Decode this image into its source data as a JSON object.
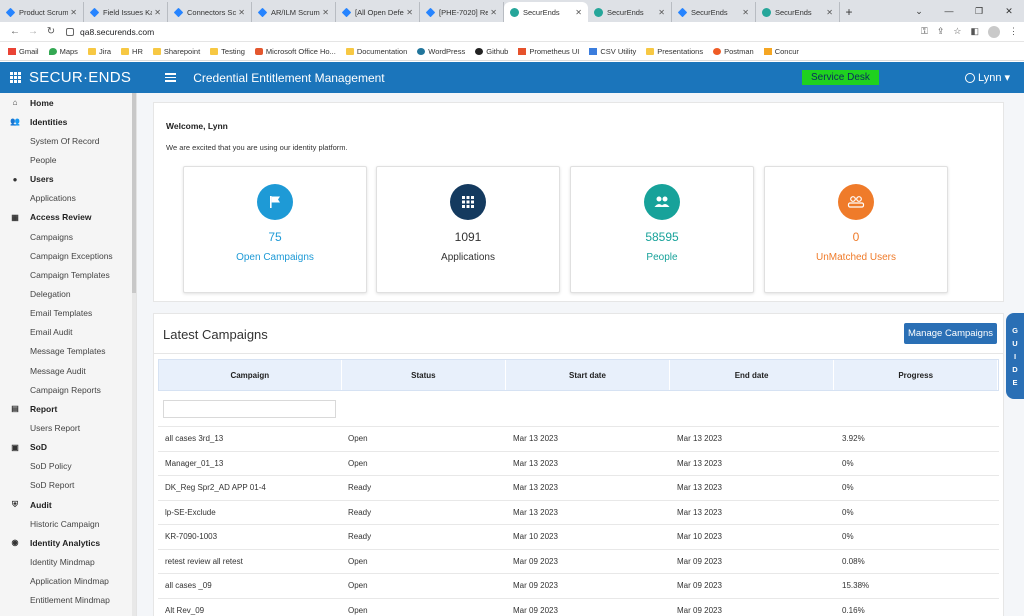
{
  "browser": {
    "tabs": [
      {
        "title": "Product Scrum",
        "type": "jira"
      },
      {
        "title": "Field Issues Ka",
        "type": "jira"
      },
      {
        "title": "Connectors Sc",
        "type": "jira"
      },
      {
        "title": "AR/ILM Scrum",
        "type": "jira"
      },
      {
        "title": "[All Open Defe",
        "type": "jira"
      },
      {
        "title": "[PHE-7020] Re",
        "type": "jira"
      },
      {
        "title": "SecurEnds",
        "type": "se",
        "active": true
      },
      {
        "title": "SecurEnds",
        "type": "se"
      },
      {
        "title": "SecurEnds",
        "type": "jira"
      },
      {
        "title": "SecurEnds",
        "type": "se"
      }
    ],
    "url": "qa8.securends.com",
    "bookmarks": [
      {
        "label": "Gmail",
        "icon": "gmail"
      },
      {
        "label": "Maps",
        "icon": "maps"
      },
      {
        "label": "Jira",
        "icon": "folder"
      },
      {
        "label": "HR",
        "icon": "folder"
      },
      {
        "label": "Sharepoint",
        "icon": "folder"
      },
      {
        "label": "Testing",
        "icon": "folder"
      },
      {
        "label": "Microsoft Office Ho...",
        "icon": "ms"
      },
      {
        "label": "Documentation",
        "icon": "folder"
      },
      {
        "label": "WordPress",
        "icon": "wp"
      },
      {
        "label": "Github",
        "icon": "gh"
      },
      {
        "label": "Prometheus UI",
        "icon": "pr"
      },
      {
        "label": "CSV Utility",
        "icon": "csv"
      },
      {
        "label": "Presentations",
        "icon": "folder"
      },
      {
        "label": "Postman",
        "icon": "pm"
      },
      {
        "label": "Concur",
        "icon": "cc"
      }
    ]
  },
  "header": {
    "logo": "SECUR·ENDS",
    "title": "Credential Entitlement Management",
    "service_desk": "Service Desk",
    "user": "Lynn",
    "brand_color": "#1b75bb"
  },
  "sidebar": {
    "items": [
      {
        "label": "Home",
        "section": true,
        "icon": "home-icon",
        "glyph": "⌂"
      },
      {
        "label": "Identities",
        "section": true,
        "icon": "people-icon",
        "glyph": "👥"
      },
      {
        "label": "System Of Record"
      },
      {
        "label": "People"
      },
      {
        "label": "Users",
        "section": true,
        "icon": "user-icon",
        "glyph": "●"
      },
      {
        "label": "Applications"
      },
      {
        "label": "Access Review",
        "section": true,
        "icon": "grid-icon",
        "glyph": "▦"
      },
      {
        "label": "Campaigns"
      },
      {
        "label": "Campaign Exceptions"
      },
      {
        "label": "Campaign Templates"
      },
      {
        "label": "Delegation"
      },
      {
        "label": "Email Templates"
      },
      {
        "label": "Email Audit"
      },
      {
        "label": "Message Templates"
      },
      {
        "label": "Message Audit"
      },
      {
        "label": "Campaign Reports"
      },
      {
        "label": "Report",
        "section": true,
        "icon": "report-icon",
        "glyph": "▤"
      },
      {
        "label": "Users Report"
      },
      {
        "label": "SoD",
        "section": true,
        "icon": "sod-icon",
        "glyph": "▣"
      },
      {
        "label": "SoD Policy"
      },
      {
        "label": "SoD Report"
      },
      {
        "label": "Audit",
        "section": true,
        "icon": "shield-icon",
        "glyph": "⛨"
      },
      {
        "label": "Historic Campaign"
      },
      {
        "label": "Identity Analytics",
        "section": true,
        "icon": "analytics-icon",
        "glyph": "◉"
      },
      {
        "label": "Identity Mindmap"
      },
      {
        "label": "Application Mindmap"
      },
      {
        "label": "Entitlement Mindmap"
      }
    ]
  },
  "welcome": {
    "title": "Welcome, Lynn",
    "subtitle": "We are excited that you are using our identity platform."
  },
  "stats": [
    {
      "value": "75",
      "label": "Open Campaigns",
      "color": "#1e9ad6",
      "text_color": "#1e9ad6",
      "icon": "flag-icon"
    },
    {
      "value": "1091",
      "label": "Applications",
      "color": "#143a5f",
      "text_color": "#333333",
      "icon": "apps-grid-icon"
    },
    {
      "value": "58595",
      "label": "People",
      "color": "#17a29a",
      "text_color": "#17a29a",
      "icon": "people-icon"
    },
    {
      "value": "0",
      "label": "UnMatched Users",
      "color": "#ef7b2a",
      "text_color": "#ef7b2a",
      "icon": "unmatched-users-icon"
    }
  ],
  "campaigns": {
    "title": "Latest Campaigns",
    "manage_label": "Manage Campaigns",
    "columns": [
      "Campaign",
      "Status",
      "Start date",
      "End date",
      "Progress"
    ],
    "rows": [
      [
        "all cases 3rd_13",
        "Open",
        "Mar 13 2023",
        "Mar 13 2023",
        "3.92%"
      ],
      [
        "Manager_01_13",
        "Open",
        "Mar 13 2023",
        "Mar 13 2023",
        "0%"
      ],
      [
        "DK_Reg Spr2_AD APP 01-4",
        "Ready",
        "Mar 13 2023",
        "Mar 13 2023",
        "0%"
      ],
      [
        "lp-SE-Exclude",
        "Ready",
        "Mar 13 2023",
        "Mar 13 2023",
        "0%"
      ],
      [
        "KR-7090-1003",
        "Ready",
        "Mar 10 2023",
        "Mar 10 2023",
        "0%"
      ],
      [
        "retest review all retest",
        "Open",
        "Mar 09 2023",
        "Mar 09 2023",
        "0.08%"
      ],
      [
        "all cases _09",
        "Open",
        "Mar 09 2023",
        "Mar 09 2023",
        "15.38%"
      ],
      [
        "Alt Rev_09",
        "Open",
        "Mar 09 2023",
        "Mar 09 2023",
        "0.16%"
      ]
    ]
  },
  "guide_label": [
    "G",
    "U",
    "I",
    "D",
    "E"
  ]
}
